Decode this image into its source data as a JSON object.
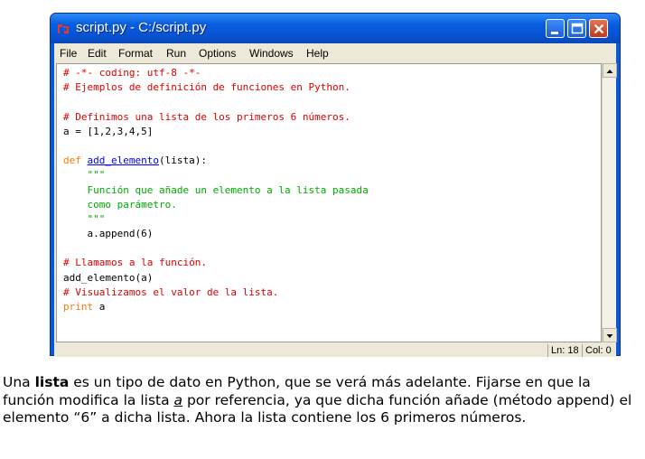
{
  "window": {
    "title": "script.py - C:/script.py",
    "menu": [
      "File",
      "Edit",
      "Format",
      "Run",
      "Options",
      "Windows",
      "Help"
    ],
    "status": {
      "line": "Ln: 18",
      "col": "Col: 0"
    }
  },
  "code_lines": [
    [
      {
        "t": "# -*- coding: utf-8 -*-",
        "c": "com"
      }
    ],
    [
      {
        "t": "# Ejemplos de definición de funciones en Python.",
        "c": "com"
      }
    ],
    [],
    [
      {
        "t": "# Definimos una lista de los primeros 6 números.",
        "c": "com"
      }
    ],
    [
      {
        "t": "a = [1,2,3,4,5]",
        "c": "txt"
      }
    ],
    [],
    [
      {
        "t": "def ",
        "c": "key"
      },
      {
        "t": "add_elemento",
        "c": "def"
      },
      {
        "t": "(lista):",
        "c": "txt"
      }
    ],
    [
      {
        "t": "    \"\"\"",
        "c": "str"
      }
    ],
    [
      {
        "t": "    Función que añade un elemento a la lista pasada",
        "c": "str"
      }
    ],
    [
      {
        "t": "    como parámetro.",
        "c": "str"
      }
    ],
    [
      {
        "t": "    \"\"\"",
        "c": "str"
      }
    ],
    [
      {
        "t": "    a.append(6)",
        "c": "txt"
      }
    ],
    [],
    [
      {
        "t": "# Llamamos a la función.",
        "c": "com"
      }
    ],
    [
      {
        "t": "add_elemento(a)",
        "c": "txt"
      }
    ],
    [
      {
        "t": "# Visualizamos el valor de la lista.",
        "c": "com"
      }
    ],
    [
      {
        "t": "print",
        "c": "key"
      },
      {
        "t": " a",
        "c": "txt"
      }
    ]
  ],
  "caption": {
    "p1": "Una ",
    "bold": "lista",
    "p2": " es un tipo de dato en Python, que se verá más adelante. Fijarse en que la función modifica la lista ",
    "italic": "a",
    "p3": " por referencia, ya que dicha función añade (método append) el elemento “6” a dicha lista. Ahora la lista contiene los 6 primeros números."
  },
  "colors": {
    "comment": "#dd0000",
    "keyword": "#ff7700",
    "defname": "#0000ff",
    "string": "#00aa00",
    "titlebar": "#0a5ad6",
    "chrome": "#ece9d8"
  },
  "icons": [
    "python-app-icon",
    "minimize-icon",
    "maximize-icon",
    "close-icon",
    "scroll-up-icon",
    "scroll-down-icon"
  ]
}
